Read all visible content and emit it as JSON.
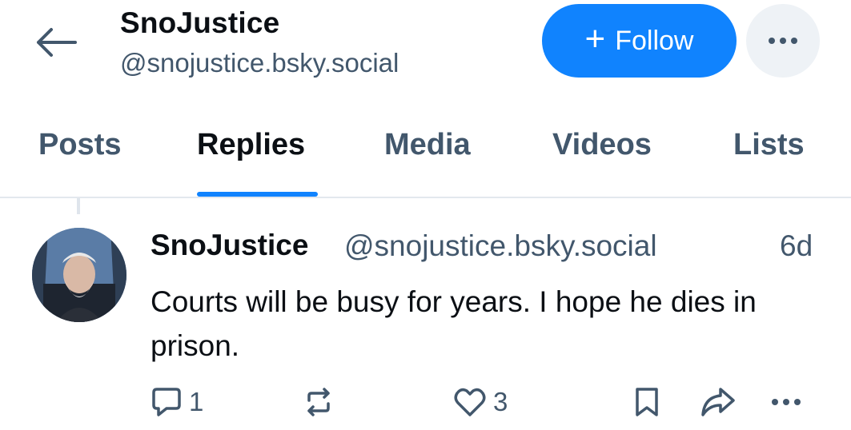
{
  "profile": {
    "display_name": "SnoJustice",
    "handle": "@snojustice.bsky.social",
    "follow_label": "Follow"
  },
  "tabs": [
    {
      "label": "Posts"
    },
    {
      "label": "Replies"
    },
    {
      "label": "Media"
    },
    {
      "label": "Videos"
    },
    {
      "label": "Lists"
    }
  ],
  "active_tab": "Replies",
  "post": {
    "author_name": "SnoJustice",
    "author_handle": "@snojustice.bsky.social",
    "time": "6d",
    "text": "Courts will be busy for years. I hope he dies in prison.",
    "reply_count": "1",
    "like_count": "3"
  },
  "colors": {
    "accent": "#1083fe",
    "muted_text": "#42576c",
    "text": "#0b0f14",
    "more_button_bg": "#eef2f6"
  },
  "icons": [
    "back-arrow-icon",
    "plus-icon",
    "ellipsis-icon",
    "reply-icon",
    "repost-icon",
    "like-icon",
    "bookmark-icon",
    "share-icon"
  ]
}
